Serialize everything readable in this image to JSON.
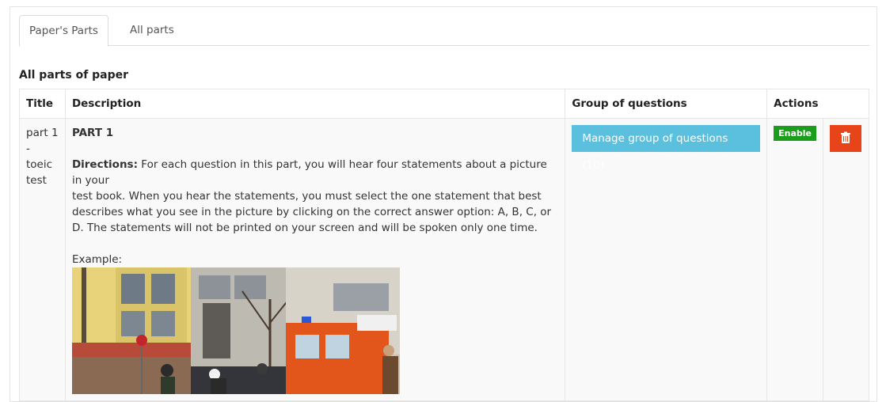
{
  "tabs": [
    {
      "label": "Paper's Parts",
      "active": true
    },
    {
      "label": "All parts",
      "active": false
    }
  ],
  "section_title": "All parts of paper",
  "table": {
    "headers": [
      "Title",
      "Description",
      "Group of questions",
      "Actions"
    ],
    "rows": [
      {
        "title": "part 1 - toeic test",
        "description": {
          "heading": "PART 1",
          "directions_label": "Directions:",
          "directions_text_1": " For each question in this part, you will hear four statements about a picture in your",
          "directions_text_2": "test book. When you hear the statements, you must select the one statement that best describes what you see in the picture by clicking on the correct answer option: A, B, C, or D. The statements will not be printed on your screen and will be spoken only one time.",
          "example_label": "Example:"
        },
        "manage_button": "Manage group of questions (10)",
        "status_badge": "Enable",
        "delete_icon": "trash-icon"
      }
    ]
  },
  "colors": {
    "manage_button": "#5bc0de",
    "enable_badge": "#1b9e1b",
    "delete_button": "#e8441a"
  }
}
